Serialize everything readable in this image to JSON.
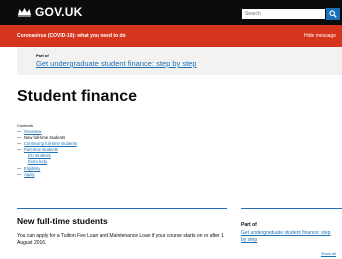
{
  "header": {
    "logo_text": "GOV.UK",
    "search_placeholder": "Search"
  },
  "banner": {
    "text": "Coronavirus (COVID-19): what you need to do",
    "hide_label": "Hide message"
  },
  "part_of_top": {
    "label": "Part of",
    "link": "Get undergraduate student finance: step by step"
  },
  "page_title": "Student finance",
  "contents": {
    "title": "Contents",
    "items": [
      {
        "label": "Overview",
        "kind": "link"
      },
      {
        "label": "New full-time students",
        "kind": "current"
      },
      {
        "label": "Continuing full-time students",
        "kind": "link"
      },
      {
        "label": "Part-time students",
        "kind": "link"
      },
      {
        "label": "EU students",
        "kind": "sub"
      },
      {
        "label": "Extra help",
        "kind": "sub"
      },
      {
        "label": "Eligibility",
        "kind": "link"
      },
      {
        "label": "Apply",
        "kind": "link"
      }
    ]
  },
  "section": {
    "heading": "New full-time students",
    "body": "You can apply for a Tuition Fee Loan and Maintenance Loan if your course starts on or after 1 August 2016."
  },
  "sidebar": {
    "label": "Part of",
    "link": "Get undergraduate student finance: step by step",
    "show_all": "Show all"
  },
  "colors": {
    "header_bg": "#0b0c0c",
    "banner_bg": "#d4351c",
    "link": "#1d70b8",
    "panel_bg": "#f3f2f1"
  }
}
